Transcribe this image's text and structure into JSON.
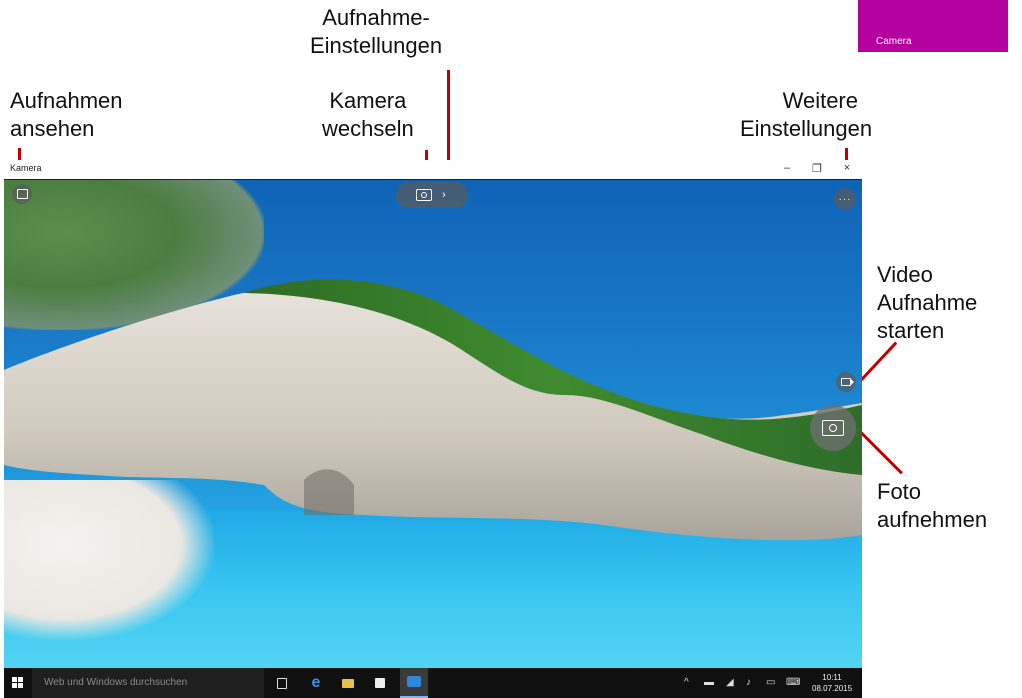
{
  "annotations": {
    "settings_top": [
      "Aufnahme-",
      "Einstellungen"
    ],
    "view_captures": [
      "Aufnahmen",
      "ansehen"
    ],
    "switch_camera": [
      "Kamera",
      "wechseln"
    ],
    "more_settings": [
      "Weitere",
      "Einstellungen"
    ],
    "start_video": [
      "Video",
      "Aufnahme",
      "starten"
    ],
    "take_photo": [
      "Foto",
      "aufnehmen"
    ]
  },
  "tile": {
    "label": "Camera",
    "color": "#b4009e"
  },
  "window": {
    "title": "Kamera",
    "minimize_glyph": "–",
    "restore_glyph": "❐",
    "close_glyph": "×"
  },
  "controls": {
    "gallery_icon": "gallery-icon",
    "switch_camera_icon": "camera-switch-icon",
    "settings_chevron": "›",
    "more_glyph": "···",
    "video_icon": "video-icon",
    "photo_icon": "camera-icon"
  },
  "taskbar": {
    "search_placeholder": "Web und Windows durchsuchen",
    "time": "10:11",
    "date": "08.07.2015"
  },
  "colors": {
    "accent_red": "#c00000",
    "taskbar": "#101010"
  }
}
